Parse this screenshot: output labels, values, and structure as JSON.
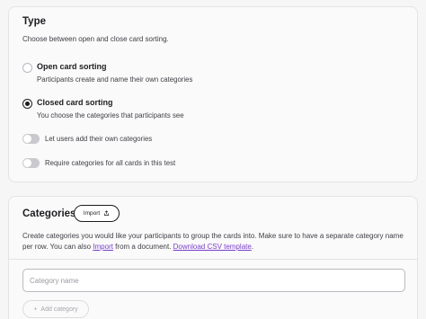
{
  "type_section": {
    "title": "Type",
    "description": "Choose between open and close card sorting.",
    "options": [
      {
        "label": "Open card sorting",
        "description": "Participants create and name their own categories",
        "selected": false
      },
      {
        "label": "Closed card sorting",
        "description": "You choose the categories that participants see",
        "selected": true
      }
    ],
    "toggles": [
      {
        "label": "Let users add their own categories",
        "on": false
      },
      {
        "label": "Require categories for all cards in this test",
        "on": false
      }
    ]
  },
  "categories_section": {
    "title": "Categories",
    "import_button": "Import",
    "import_icon": "upload-icon",
    "description_part1": "Create categories you would like your participants to group the cards into. Make sure to have a separate category name per row. You can also ",
    "import_link": "Import",
    "description_part2": " from a document. ",
    "download_link": "Download CSV template",
    "description_part3": ".",
    "input_placeholder": "Category name",
    "add_button": "Add category",
    "add_icon": "plus-icon"
  },
  "colors": {
    "link": "#7b3fc9",
    "text": "#1d1d21",
    "muted": "#3f3f46"
  }
}
